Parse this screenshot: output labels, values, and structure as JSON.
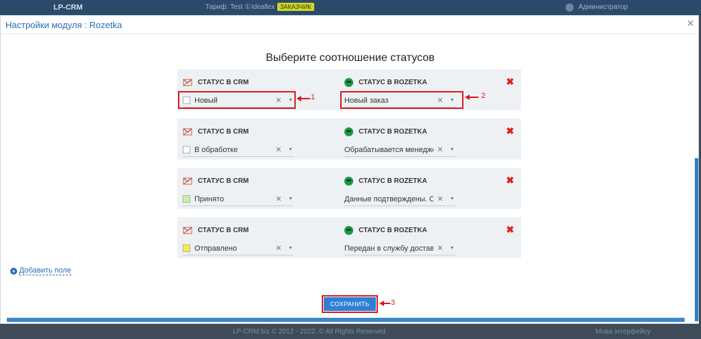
{
  "background": {
    "logo": "LP-CRM",
    "tariff": "Тариф: Test ①",
    "mode": "Ideallex",
    "badge": "ЗАКАЗЧИК",
    "user": "Администратор",
    "copyright": "LP-CRM.biz © 2012 - 2022. © All Rights Reserved",
    "language": "Мова інтерфейсу"
  },
  "modal": {
    "title": "Настройки модуля : Rozetka",
    "close_icon": "×"
  },
  "section_title": "Выберите соотношение статусов",
  "labels": {
    "crm_status": "СТАТУС В CRM",
    "rozetka_status": "СТАТУС В ROZETKA"
  },
  "rows": [
    {
      "crm_status": "Новый",
      "crm_color": "#ffffff",
      "rozetka_status": "Новый заказ"
    },
    {
      "crm_status": "В обработке",
      "crm_color": "#ffffff",
      "rozetka_status": "Обрабатывается менеджером"
    },
    {
      "crm_status": "Принято",
      "crm_color": "#c8f0a0",
      "rozetka_status": "Данные подтверждены. Ожидает отправки"
    },
    {
      "crm_status": "Отправлено",
      "crm_color": "#f8f030",
      "rozetka_status": "Передан в службу доставки"
    }
  ],
  "clear_glyph": "✕",
  "arrow_glyph": "▼",
  "delete_glyph": "✖",
  "add_field": {
    "icon": "+",
    "label": "Добавить поле"
  },
  "save_button": "СОХРАНИТЬ",
  "callouts": [
    "1",
    "2",
    "3"
  ],
  "colors": {
    "accent": "#2a6bb0",
    "save": "#2e7fd6",
    "delete": "#e02020",
    "highlight": "#d9181c",
    "rozetka": "#1a9a44"
  }
}
